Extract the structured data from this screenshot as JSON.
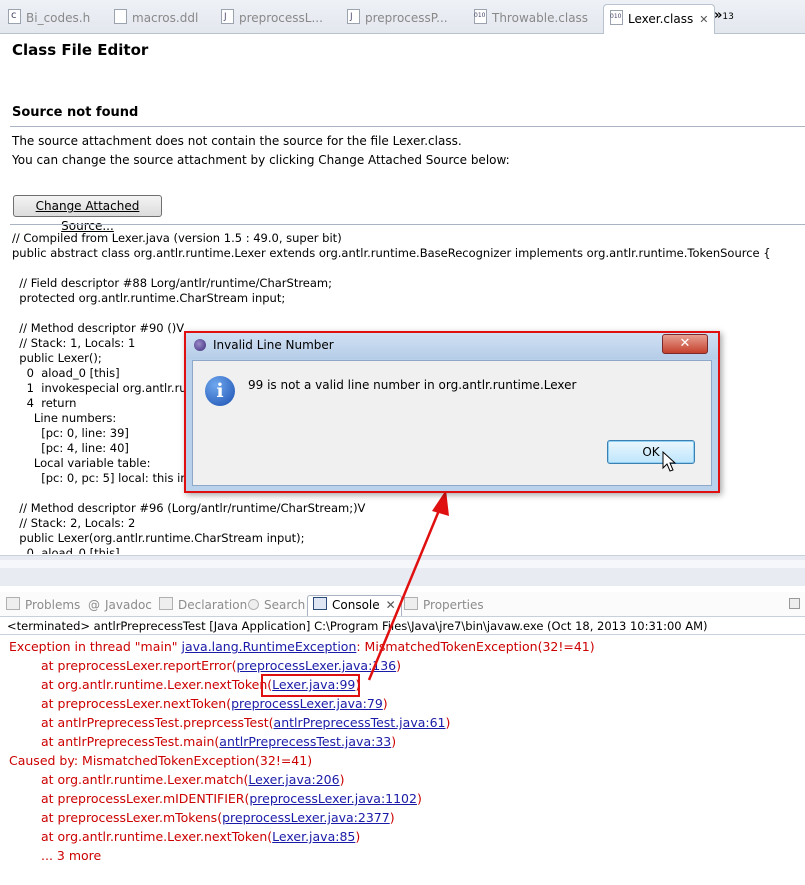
{
  "tabs": [
    {
      "label": "Bi_codes.h",
      "icon": "c-file-icon"
    },
    {
      "label": "macros.ddl",
      "icon": "file-icon"
    },
    {
      "label": "preprocessL...",
      "icon": "java-file-icon"
    },
    {
      "label": "preprocessP...",
      "icon": "java-file-icon"
    },
    {
      "label": "Throwable.class",
      "icon": "class-file-icon"
    },
    {
      "label": "Lexer.class",
      "icon": "class-file-icon",
      "active": true
    }
  ],
  "tab_overflow": {
    "symbol": "»",
    "count": "13"
  },
  "editor": {
    "title": "Class File Editor",
    "source_heading": "Source not found",
    "message1": "The source attachment does not contain the source for the file Lexer.class.",
    "message2": "You can change the source attachment by clicking Change Attached Source below:",
    "change_button": "Change Attached Source...",
    "code_lines": [
      "// Compiled from Lexer.java (version 1.5 : 49.0, super bit)",
      "public abstract class org.antlr.runtime.Lexer extends org.antlr.runtime.BaseRecognizer implements org.antlr.runtime.TokenSource {",
      "",
      "  // Field descriptor #88 Lorg/antlr/runtime/CharStream;",
      "  protected org.antlr.runtime.CharStream input;",
      "",
      "  // Method descriptor #90 ()V",
      "  // Stack: 1, Locals: 1",
      "  public Lexer();",
      "    0  aload_0 [this]",
      "    1  invokespecial org.antlr.runti",
      "    4  return",
      "      Line numbers:",
      "        [pc: 0, line: 39]",
      "        [pc: 4, line: 40]",
      "      Local variable table:",
      "        [pc: 0, pc: 5] local: this index",
      "",
      "  // Method descriptor #96 (Lorg/antlr/runtime/CharStream;)V",
      "  // Stack: 2, Locals: 2",
      "  public Lexer(org.antlr.runtime.CharStream input);",
      "    0  aload_0 [this]"
    ]
  },
  "view_tabs": [
    {
      "label": "Problems",
      "icon": "problems-icon"
    },
    {
      "label": "Javadoc",
      "icon": "javadoc-icon"
    },
    {
      "label": "Declaration",
      "icon": "declaration-icon"
    },
    {
      "label": "Search",
      "icon": "search-icon"
    },
    {
      "label": "Console",
      "icon": "console-icon",
      "active": true
    },
    {
      "label": "Properties",
      "icon": "properties-icon"
    }
  ],
  "console": {
    "terminated": "<terminated> antlrPreprecessTest [Java Application] C:\\Program Files\\Java\\jre7\\bin\\javaw.exe (Oct 18, 2013 10:31:00 AM)",
    "lines": [
      {
        "indent": false,
        "pre": "Exception in thread \"main\" ",
        "link": "java.lang.RuntimeException",
        "post": ": MismatchedTokenException(32!=41)"
      },
      {
        "indent": true,
        "pre": "at preprocessLexer.reportError(",
        "link": "preprocessLexer.java:136",
        "post": ")"
      },
      {
        "indent": true,
        "pre": "at org.antlr.runtime.Lexer.nextToken(",
        "link": "Lexer.java:99",
        "post": ")"
      },
      {
        "indent": true,
        "pre": "at preprocessLexer.nextToken(",
        "link": "preprocessLexer.java:79",
        "post": ")"
      },
      {
        "indent": true,
        "pre": "at antlrPreprecessTest.preprcessTest(",
        "link": "antlrPreprecessTest.java:61",
        "post": ")"
      },
      {
        "indent": true,
        "pre": "at antlrPreprecessTest.main(",
        "link": "antlrPreprecessTest.java:33",
        "post": ")"
      },
      {
        "indent": false,
        "pre": "Caused by: MismatchedTokenException(32!=41)",
        "link": "",
        "post": ""
      },
      {
        "indent": true,
        "pre": "at org.antlr.runtime.Lexer.match(",
        "link": "Lexer.java:206",
        "post": ")"
      },
      {
        "indent": true,
        "pre": "at preprocessLexer.mIDENTIFIER(",
        "link": "preprocessLexer.java:1102",
        "post": ")"
      },
      {
        "indent": true,
        "pre": "at preprocessLexer.mTokens(",
        "link": "preprocessLexer.java:2377",
        "post": ")"
      },
      {
        "indent": true,
        "pre": "at org.antlr.runtime.Lexer.nextToken(",
        "link": "Lexer.java:85",
        "post": ")"
      },
      {
        "indent": true,
        "pre": "... 3 more",
        "link": "",
        "post": ""
      }
    ]
  },
  "dialog": {
    "title": "Invalid Line Number",
    "message": "99 is not a valid line number in org.antlr.runtime.Lexer",
    "ok_label": "OK",
    "close_symbol": "✕",
    "info_symbol": "i"
  },
  "colors": {
    "error_text": "#cc0000",
    "link_text": "#1a1aa8",
    "annotation_red": "#e01010"
  }
}
